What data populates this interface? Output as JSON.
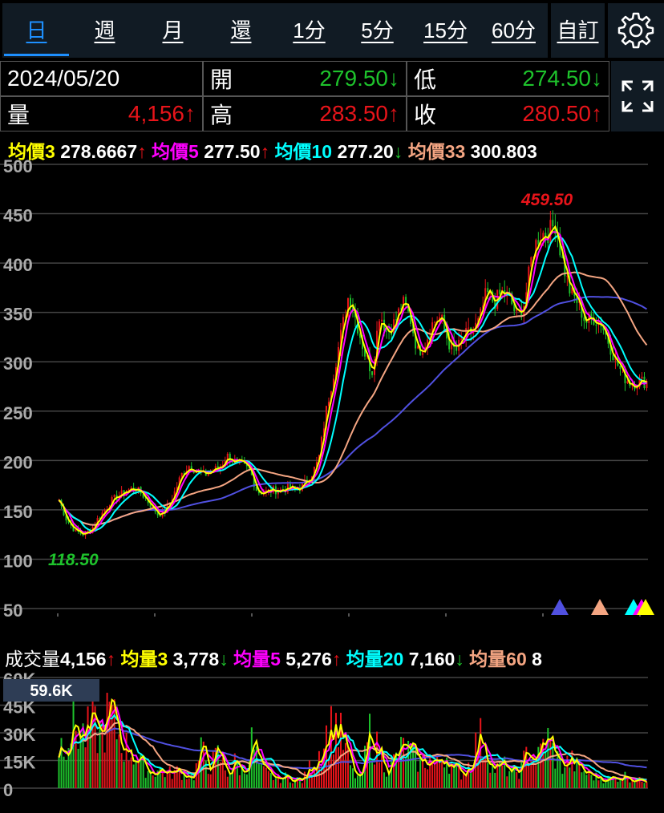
{
  "tabs": [
    {
      "label": "日",
      "active": true
    },
    {
      "label": "週"
    },
    {
      "label": "月"
    },
    {
      "label": "還"
    },
    {
      "label": "1分"
    },
    {
      "label": "5分"
    },
    {
      "label": "15分"
    },
    {
      "label": "60分"
    }
  ],
  "custom_label": "自訂",
  "settings_icon": "gear-icon",
  "expand_icon": "expand-arrows-icon",
  "quote": {
    "date": "2024/05/20",
    "open_label": "開",
    "open": "279.50↓",
    "low_label": "低",
    "low": "274.50↓",
    "volume_label": "量",
    "volume": "4,156↑",
    "high_label": "高",
    "high": "283.50↑",
    "close_label": "收",
    "close": "280.50↑"
  },
  "ma_legend": [
    {
      "label": "均價3",
      "value": "278.6667",
      "arrow": "↑",
      "color": "#ffff00"
    },
    {
      "label": "均價5",
      "value": "277.50",
      "arrow": "↑",
      "color": "#ff00ff"
    },
    {
      "label": "均價10",
      "value": "277.20",
      "arrow": "↓",
      "color": "#00ffff"
    },
    {
      "label": "均價33",
      "value": "300.803",
      "arrow": "",
      "color": "#f4a582"
    }
  ],
  "vol_legend": {
    "label": "成交量",
    "value": "4,156",
    "arrow": "↑",
    "items": [
      {
        "label": "均量3",
        "value": "3,778",
        "arrow": "↓",
        "color": "#ffff00"
      },
      {
        "label": "均量5",
        "value": "5,276",
        "arrow": "↑",
        "color": "#ff00ff"
      },
      {
        "label": "均量20",
        "value": "7,160",
        "arrow": "↓",
        "color": "#00ffff"
      },
      {
        "label": "均量60",
        "value": "8",
        "arrow": "",
        "color": "#f4a582"
      }
    ]
  },
  "colors": {
    "up": "#e8141a",
    "down": "#1ec32c",
    "ma_long": "#5050e0"
  },
  "chart_data": [
    {
      "type": "candlestick",
      "ylim": [
        50,
        500
      ],
      "yticks": [
        500,
        450,
        400,
        350,
        300,
        250,
        200,
        150,
        100,
        50
      ],
      "grid": true,
      "max_label": "459.50",
      "min_label": "118.50",
      "close_approx": [
        160,
        140,
        130,
        125,
        128,
        140,
        150,
        160,
        165,
        170,
        172,
        165,
        155,
        145,
        150,
        165,
        185,
        195,
        190,
        185,
        190,
        192,
        205,
        198,
        195,
        190,
        168,
        168,
        170,
        170,
        172,
        170,
        175,
        185,
        200,
        250,
        290,
        330,
        370,
        340,
        310,
        290,
        350,
        330,
        340,
        360,
        345,
        310,
        320,
        340,
        345,
        320,
        310,
        325,
        330,
        340,
        370,
        360,
        370,
        365,
        345,
        360,
        410,
        430,
        430,
        440,
        400,
        370,
        360,
        340,
        345,
        340,
        320,
        300,
        285,
        278,
        280,
        280
      ],
      "markers": [
        {
          "color": "#5050e0"
        },
        {
          "color": "#f4a582"
        },
        {
          "color": "#00ffff"
        },
        {
          "color": "#ff00ff"
        },
        {
          "color": "#ffff00"
        }
      ]
    },
    {
      "type": "bar",
      "ylim": [
        0,
        60000
      ],
      "yticks": [
        "60K",
        "45K",
        "30K",
        "15K",
        "0"
      ],
      "cursor_label": "59.6K",
      "volume_approx_k": [
        22,
        30,
        33,
        28,
        32,
        30,
        40,
        30,
        22,
        18,
        12,
        9,
        10,
        8,
        9,
        8,
        6,
        20,
        12,
        18,
        8,
        14,
        8,
        25,
        10,
        7,
        5,
        6,
        5,
        4,
        12,
        20,
        30,
        35,
        22,
        8,
        5,
        30,
        20,
        12,
        15,
        22,
        18,
        14,
        16,
        12,
        20,
        10,
        8,
        14,
        28,
        20,
        10,
        12,
        8,
        10,
        22,
        15,
        28,
        18,
        12,
        15,
        10,
        8,
        6,
        5,
        5,
        7,
        6,
        4,
        5
      ]
    }
  ]
}
